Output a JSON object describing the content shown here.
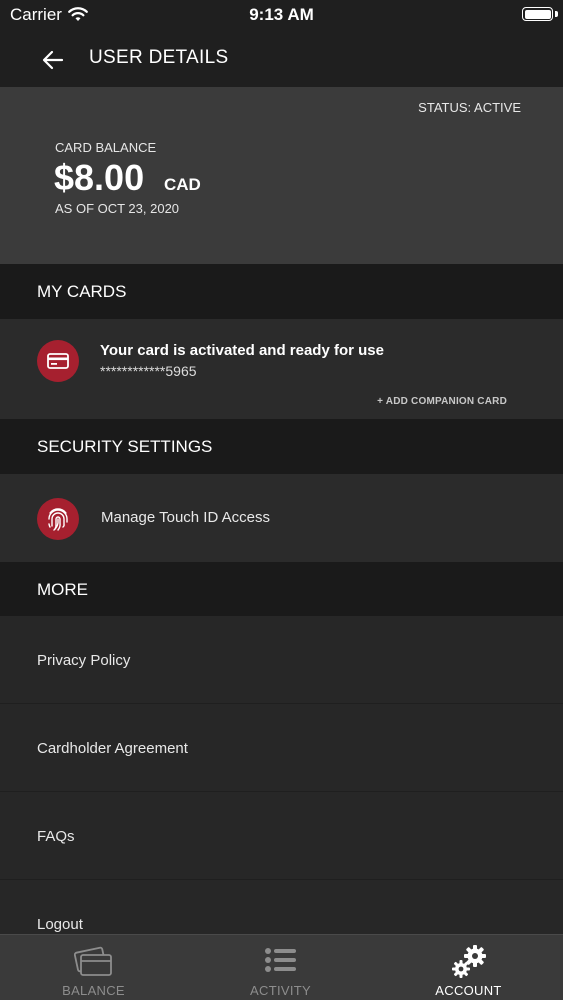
{
  "status_bar": {
    "carrier": "Carrier",
    "time": "9:13 AM"
  },
  "nav": {
    "title": "USER DETAILS",
    "back_icon": "back-arrow-icon"
  },
  "balance": {
    "status": "STATUS: ACTIVE",
    "label": "CARD BALANCE",
    "amount": "$8.00",
    "currency": "CAD",
    "as_of": "AS OF OCT 23, 2020"
  },
  "my_cards": {
    "header": "MY CARDS",
    "icon": "credit-card-icon",
    "title": "Your card is activated and ready for use",
    "masked_number": "************5965",
    "add_companion": "+ ADD COMPANION CARD"
  },
  "security": {
    "header": "SECURITY SETTINGS",
    "icon": "fingerprint-icon",
    "touch_id_label": "Manage Touch ID Access"
  },
  "more": {
    "header": "MORE",
    "items": [
      {
        "label": "Privacy Policy"
      },
      {
        "label": "Cardholder Agreement"
      },
      {
        "label": "FAQs"
      },
      {
        "label": "Logout"
      }
    ]
  },
  "tabs": [
    {
      "label": "BALANCE",
      "icon": "card-stack-icon",
      "active": false
    },
    {
      "label": "ACTIVITY",
      "icon": "list-icon",
      "active": false
    },
    {
      "label": "ACCOUNT",
      "icon": "gears-icon",
      "active": true
    }
  ],
  "colors": {
    "accent": "#a6202f",
    "background": "#272727",
    "header": "#1a1a1a",
    "balance_panel": "#3b3b3b",
    "tab_bar": "#3a3a3a"
  }
}
